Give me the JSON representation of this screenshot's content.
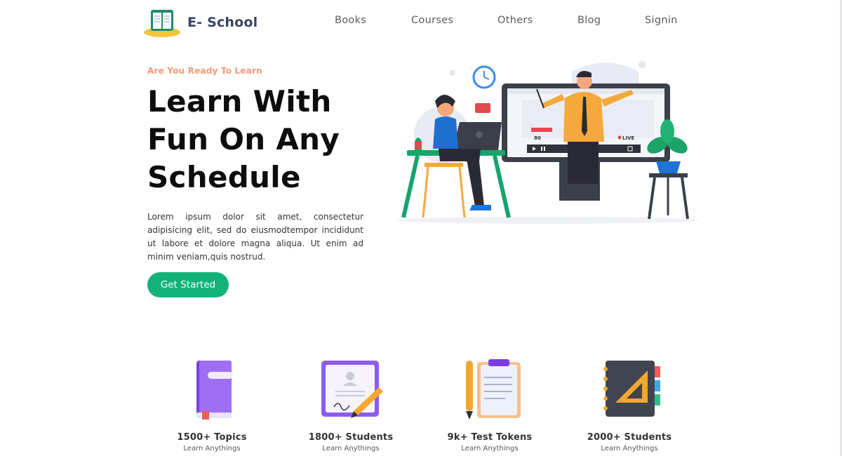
{
  "brand": {
    "name": "E- School"
  },
  "nav": {
    "items": [
      {
        "label": "Books"
      },
      {
        "label": "Courses"
      },
      {
        "label": "Others"
      },
      {
        "label": "Blog"
      },
      {
        "label": "Signin"
      }
    ]
  },
  "hero": {
    "eyebrow": "Are You Ready To Learn",
    "title": "Learn With Fun On Any Schedule",
    "description": "Lorem ipsum dolor sit amet, consectetur adipisicing elit, sed do eiusmodtempor incididunt ut labore et dolore magna aliqua. Ut enim ad minim veniam,quis nostrud.",
    "cta_label": "Get Started",
    "illustration": {
      "live_label": "LIVE",
      "viewer_count": "80"
    }
  },
  "stats": [
    {
      "title": "1500+ Topics",
      "subtitle": "Learn Anythings",
      "icon": "book-icon"
    },
    {
      "title": "1800+ Students",
      "subtitle": "Learn Anythings",
      "icon": "certificate-pen-icon"
    },
    {
      "title": "9k+ Test Tokens",
      "subtitle": "Learn Anythings",
      "icon": "clipboard-pencil-icon"
    },
    {
      "title": "2000+ Students",
      "subtitle": "Learn Anythings",
      "icon": "notebook-ruler-icon"
    }
  ],
  "colors": {
    "accent": "#13b27a",
    "eyebrow": "#f29a76",
    "brand_text": "#3a4363"
  }
}
